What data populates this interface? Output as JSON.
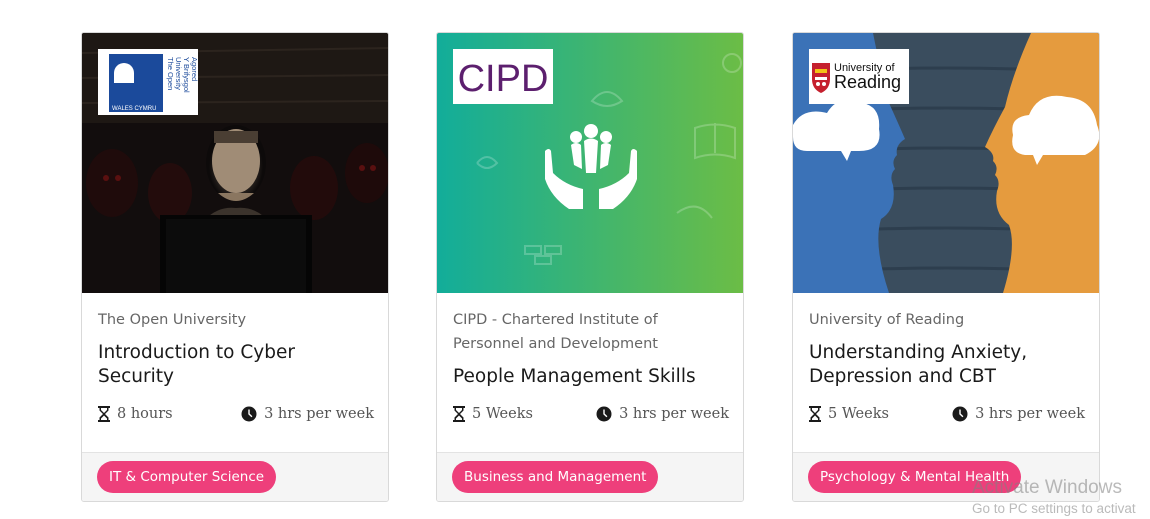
{
  "cards": [
    {
      "provider": "The Open University",
      "logo_text": "The Open University Y Brifysgol Agored WALES CYMRU",
      "title": "Introduction to Cyber Security",
      "duration_icon": "hourglass-icon",
      "duration": "8 hours",
      "effort_icon": "clock-icon",
      "effort": "3 hrs per week",
      "category": "IT & Computer Science"
    },
    {
      "provider": "CIPD - Chartered Institute of Personnel and Development",
      "logo_text": "CIPD",
      "title": "People Management Skills",
      "duration_icon": "hourglass-icon",
      "duration": "5 Weeks",
      "effort_icon": "clock-icon",
      "effort": "3 hrs per week",
      "category": "Business and Management"
    },
    {
      "provider": "University of Reading",
      "logo_text": "University of Reading",
      "title": "Understanding Anxiety, Depression and CBT",
      "duration_icon": "hourglass-icon",
      "duration": "5 Weeks",
      "effort_icon": "clock-icon",
      "effort": "3 hrs per week",
      "category": "Psychology & Mental Health"
    }
  ],
  "colors": {
    "badge": "#ee3f7b",
    "footer": "#f5f5f5",
    "cipd_purple": "#5c1f6e"
  },
  "watermark": {
    "line1": "Activate Windows",
    "line2": "Go to PC settings to activat"
  }
}
